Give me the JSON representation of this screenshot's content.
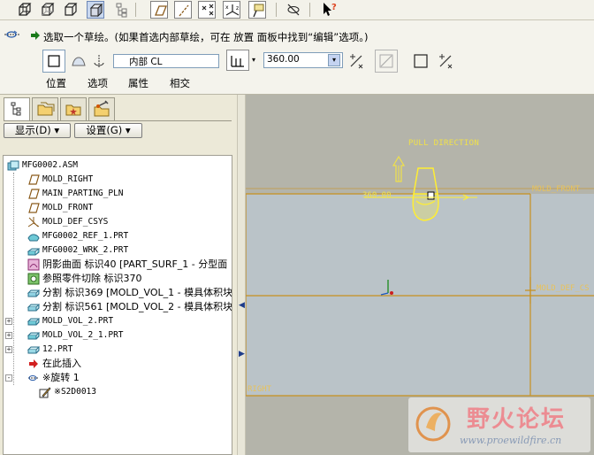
{
  "toolbar": {
    "icons": [
      "wireframe-icon",
      "hidden-line-icon",
      "no-hidden-icon",
      "shading-icon",
      "model-tree-icon",
      "datum-planes-icon",
      "datum-axes-icon",
      "datum-points-icon",
      "coordinate-systems-icon",
      "annotations-icon",
      "spin-center-icon",
      "whats-this-help-icon"
    ]
  },
  "dashboard": {
    "prompt": "选取一个草绘。(如果首选内部草绘，可在 放置 面板中找到“编辑”选项。)",
    "sketch_field": "内部 CL",
    "angle_value": "360.00",
    "tabs": [
      "位置",
      "选项",
      "属性",
      "相交"
    ]
  },
  "navigator": {
    "show_button": "显示(D)",
    "settings_button": "设置(G)",
    "tree": [
      {
        "text": "MFG0002.ASM",
        "icon": "assembly-icon",
        "indent": 0,
        "expand": ""
      },
      {
        "text": "MOLD_RIGHT",
        "icon": "datum-plane-icon",
        "indent": 1,
        "expand": ""
      },
      {
        "text": "MAIN_PARTING_PLN",
        "icon": "datum-plane-icon",
        "indent": 1,
        "expand": ""
      },
      {
        "text": "MOLD_FRONT",
        "icon": "datum-plane-icon",
        "indent": 1,
        "expand": ""
      },
      {
        "text": "MOLD_DEF_CSYS",
        "icon": "csys-icon",
        "indent": 1,
        "expand": ""
      },
      {
        "text": "MFG0002_REF_1.PRT",
        "icon": "reference-part-icon",
        "indent": 1,
        "expand": ""
      },
      {
        "text": "MFG0002_WRK_2.PRT",
        "icon": "workpiece-icon",
        "indent": 1,
        "expand": ""
      },
      {
        "text": "阴影曲面 标识40 [PART_SURF_1 - 分型面",
        "icon": "shadow-surface-icon",
        "indent": 1,
        "expand": ""
      },
      {
        "text": "参照零件切除 标识370",
        "icon": "ref-part-cutout-icon",
        "indent": 1,
        "expand": ""
      },
      {
        "text": "分割 标识369 [MOLD_VOL_1 - 模具体积块",
        "icon": "split-icon",
        "indent": 1,
        "expand": ""
      },
      {
        "text": "分割 标识561 [MOLD_VOL_2 - 模具体积块",
        "icon": "split-icon",
        "indent": 1,
        "expand": ""
      },
      {
        "text": "MOLD_VOL_2.PRT",
        "icon": "mold-volume-icon",
        "indent": 1,
        "expand": "+"
      },
      {
        "text": "MOLD_VOL_2_1.PRT",
        "icon": "mold-volume-icon",
        "indent": 1,
        "expand": "+"
      },
      {
        "text": "12.PRT",
        "icon": "part-icon",
        "indent": 1,
        "expand": "+"
      },
      {
        "text": "在此插入",
        "icon": "insert-here-arrow-icon",
        "indent": 1,
        "expand": ""
      },
      {
        "text": "※旋转 1",
        "icon": "revolve-icon",
        "indent": 1,
        "expand": "-"
      },
      {
        "text": "※S2D0013",
        "icon": "sketch-icon",
        "indent": 2,
        "expand": ""
      }
    ]
  },
  "graphics": {
    "pull_direction": "PULL DIRECTION",
    "dim_value": "360.00",
    "labels": {
      "mold_front": "MOLD_FRONT",
      "mold_def_csys": "MOLD_DEF_CS",
      "right": "RIGHT"
    }
  },
  "watermark": {
    "title": "野火论坛",
    "url": "www.proewildfire.cn"
  },
  "colors": {
    "datum": "#c8901f",
    "datum_text": "#e7c25c",
    "preview": "#ffee33",
    "viewport_bg": "#b4b4aa",
    "block_fill": "#bac3c8"
  }
}
